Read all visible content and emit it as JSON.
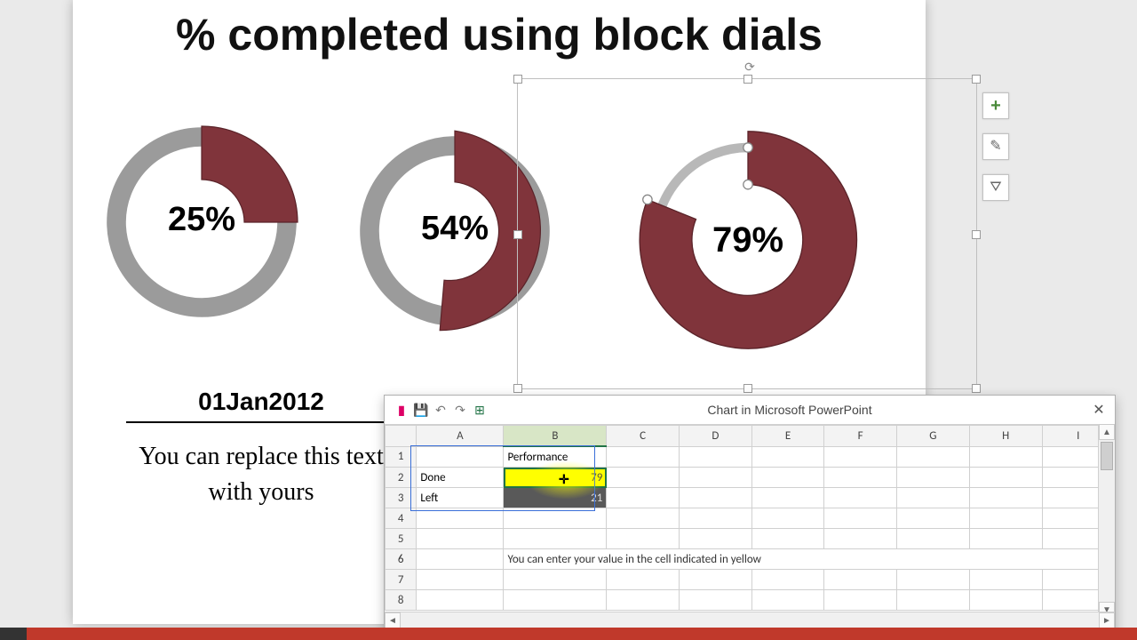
{
  "title": "% completed using block dials",
  "date_label": "01Jan2012",
  "footer_text": "You can replace this text with yours",
  "dials": [
    {
      "pct_label": "25%",
      "value": 25
    },
    {
      "pct_label": "54%",
      "value": 54
    },
    {
      "pct_label": "79%",
      "value": 79
    }
  ],
  "chart_tools": {
    "plus": "+",
    "brush": "✎",
    "funnel": "⛛"
  },
  "sheet": {
    "title": "Chart in Microsoft PowerPoint",
    "toolbar": {
      "chart": "▮",
      "save": "💾",
      "undo": "↶",
      "redo": "↷",
      "excel": "⊞"
    },
    "close": "✕",
    "cols": [
      "A",
      "B",
      "C",
      "D",
      "E",
      "F",
      "G",
      "H",
      "I"
    ],
    "rows": [
      "1",
      "2",
      "3",
      "4",
      "5",
      "6",
      "7",
      "8"
    ],
    "b1": "Performance",
    "a2": "Done",
    "b2": "79",
    "a3": "Left",
    "b3": "21",
    "hint": "You can enter your value in the cell indicated in yellow",
    "scroll": {
      "left": "◄",
      "right": "►",
      "up": "▲",
      "down": "▼"
    }
  },
  "chart_data": [
    {
      "type": "pie",
      "title": "",
      "series": [
        {
          "name": "Performance",
          "values": [
            25,
            75
          ]
        }
      ],
      "categories": [
        "Done",
        "Left"
      ],
      "center_label": "25%"
    },
    {
      "type": "pie",
      "title": "",
      "series": [
        {
          "name": "Performance",
          "values": [
            54,
            46
          ]
        }
      ],
      "categories": [
        "Done",
        "Left"
      ],
      "center_label": "54%"
    },
    {
      "type": "pie",
      "title": "",
      "series": [
        {
          "name": "Performance",
          "values": [
            79,
            21
          ]
        }
      ],
      "categories": [
        "Done",
        "Left"
      ],
      "center_label": "79%"
    }
  ]
}
